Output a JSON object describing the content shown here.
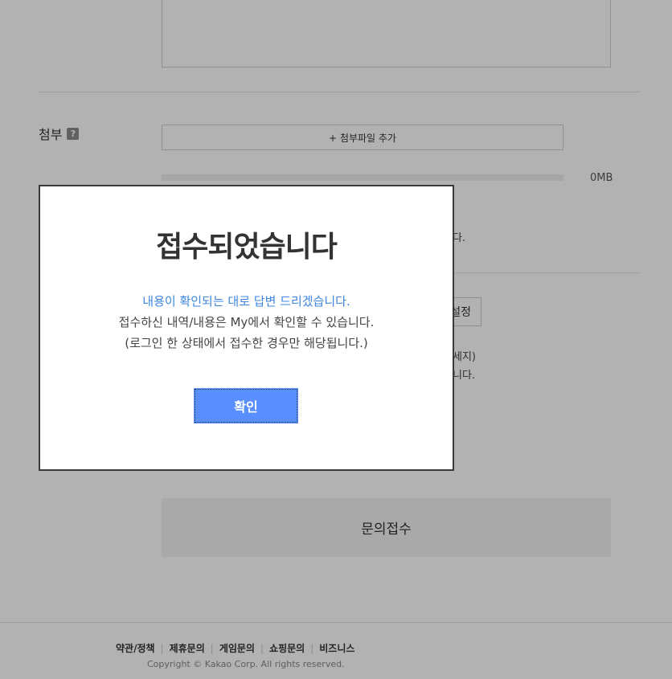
{
  "form": {
    "attach_label": "첨부",
    "help_icon": "?",
    "add_file_label": "+ 첨부파일 추가",
    "upload_size": "0MB",
    "upload_progress": 0,
    "notice_fragment_1": "다.",
    "setting_fragment": "설정",
    "notice_fragment_2": "세지)",
    "notice_fragment_3": "니다.",
    "submit_label": "문의접수"
  },
  "footer": {
    "links": [
      "약관/정책",
      "제휴문의",
      "게임문의",
      "쇼핑문의",
      "비즈니스"
    ],
    "copyright": "Copyright © Kakao Corp. All rights reserved."
  },
  "modal": {
    "title": "접수되었습니다",
    "message_highlight": "내용이 확인되는 대로 답변 드리겠습니다.",
    "message_line2": "접수하신 내역/내용은 My에서 확인할 수 있습니다.",
    "message_line3": "(로그인 한 상태에서 접수한 경우만 해당됩니다.)",
    "confirm_label": "확인"
  },
  "colors": {
    "accent": "#5a8fff",
    "highlight_text": "#3d86e0",
    "overlay": "rgba(0,0,0,0.30)"
  }
}
